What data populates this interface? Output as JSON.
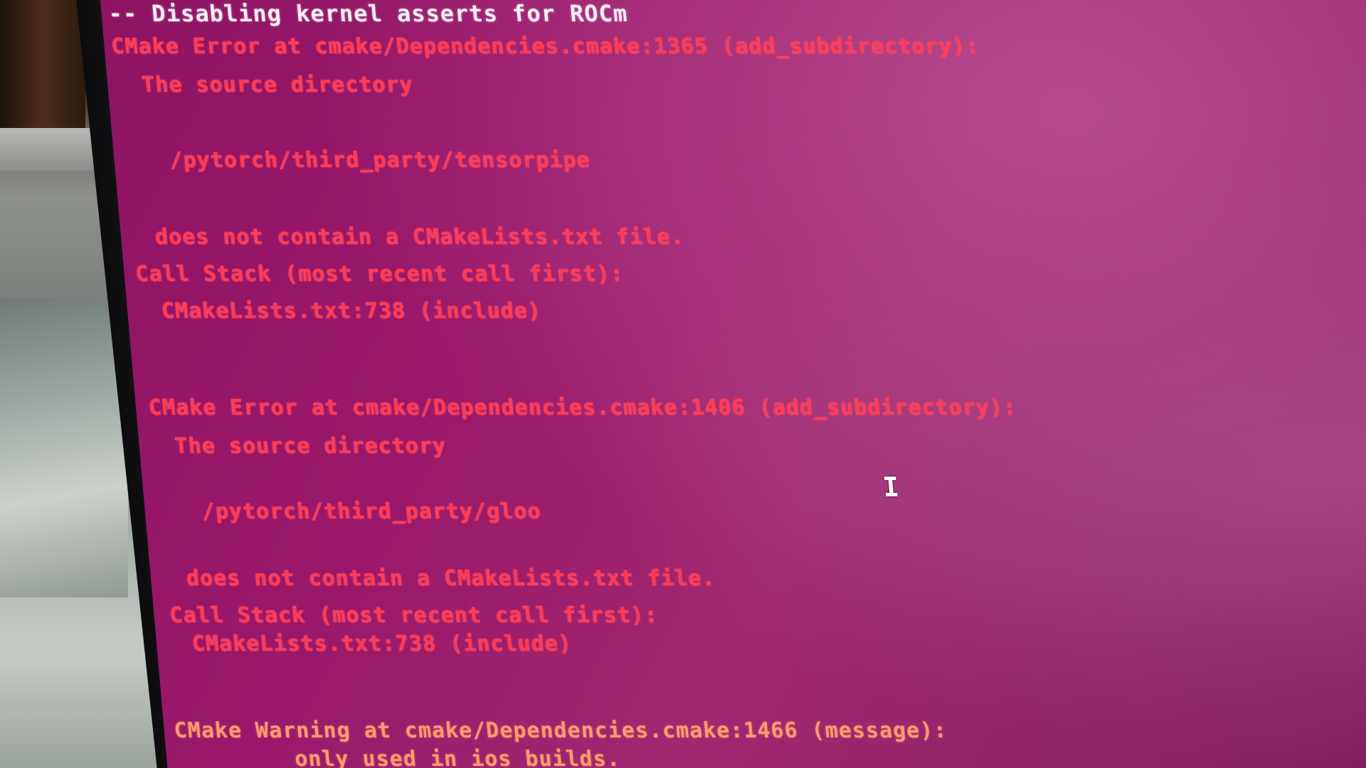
{
  "terminal": {
    "lines": [
      {
        "kind": "info",
        "text": "-- Disabling kernel asserts for ROCm"
      },
      {
        "kind": "error",
        "text": "CMake Error at cmake/Dependencies.cmake:1365 (add_subdirectory):"
      },
      {
        "kind": "error",
        "text": "The source directory"
      },
      {
        "kind": "error",
        "text": "/pytorch/third_party/tensorpipe"
      },
      {
        "kind": "error",
        "text": "does not contain a CMakeLists.txt file."
      },
      {
        "kind": "error",
        "text": "Call Stack (most recent call first):"
      },
      {
        "kind": "error",
        "text": "CMakeLists.txt:738 (include)"
      },
      {
        "kind": "error",
        "text": "CMake Error at cmake/Dependencies.cmake:1406 (add_subdirectory):"
      },
      {
        "kind": "error",
        "text": "The source directory"
      },
      {
        "kind": "error",
        "text": "/pytorch/third_party/gloo"
      },
      {
        "kind": "error",
        "text": "does not contain a CMakeLists.txt file."
      },
      {
        "kind": "error",
        "text": "Call Stack (most recent call first):"
      },
      {
        "kind": "error",
        "text": "CMakeLists.txt:738 (include)"
      },
      {
        "kind": "warning",
        "text": "CMake Warning at cmake/Dependencies.cmake:1466 (message):"
      },
      {
        "kind": "warning",
        "text": "only used in ios builds."
      }
    ]
  },
  "cursor": {
    "icon": "text-cursor-icon",
    "glyph": "I"
  },
  "colors": {
    "terminal_bg": "#9a186b",
    "error_text": "#ff3b55",
    "info_text": "#f6eef3",
    "warning_text": "#ff9a6e"
  }
}
